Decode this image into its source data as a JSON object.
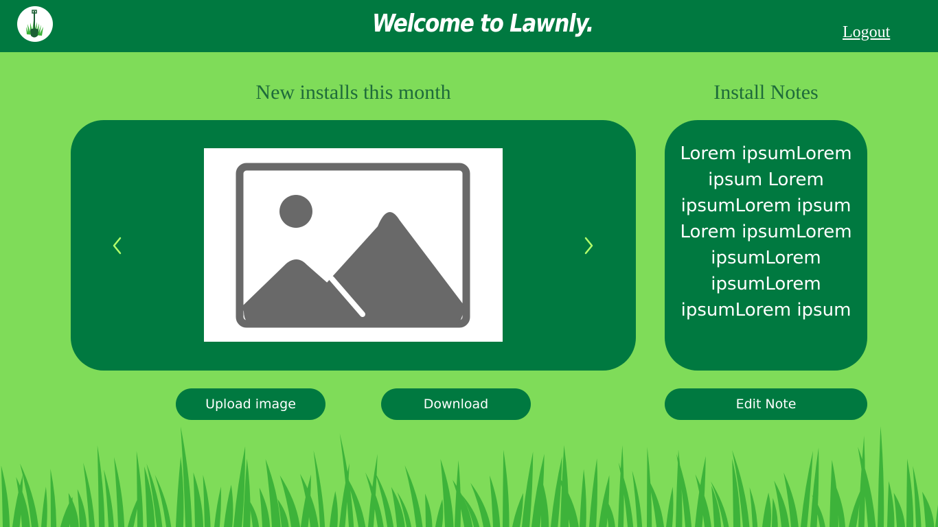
{
  "header": {
    "title": "Welcome to Lawnly.",
    "logout_label": "Logout",
    "logo_icon": "shovel-grass-logo-icon"
  },
  "installs": {
    "title": "New installs this month",
    "image_placeholder_icon": "image-placeholder-icon",
    "prev_icon": "chevron-left-icon",
    "next_icon": "chevron-right-icon"
  },
  "notes": {
    "title": "Install Notes",
    "text": "Lorem ipsumLorem ipsum Lorem ipsumLorem ipsum Lorem ipsumLorem ipsumLorem ipsumLorem ipsumLorem ipsum"
  },
  "buttons": {
    "upload_label": "Upload image",
    "download_label": "Download",
    "edit_note_label": "Edit Note"
  },
  "colors": {
    "background": "#7fdc59",
    "brand_dark": "#007940",
    "chevron": "#b3ff6b",
    "grass": "#3db33a",
    "placeholder_gray": "#696969"
  }
}
